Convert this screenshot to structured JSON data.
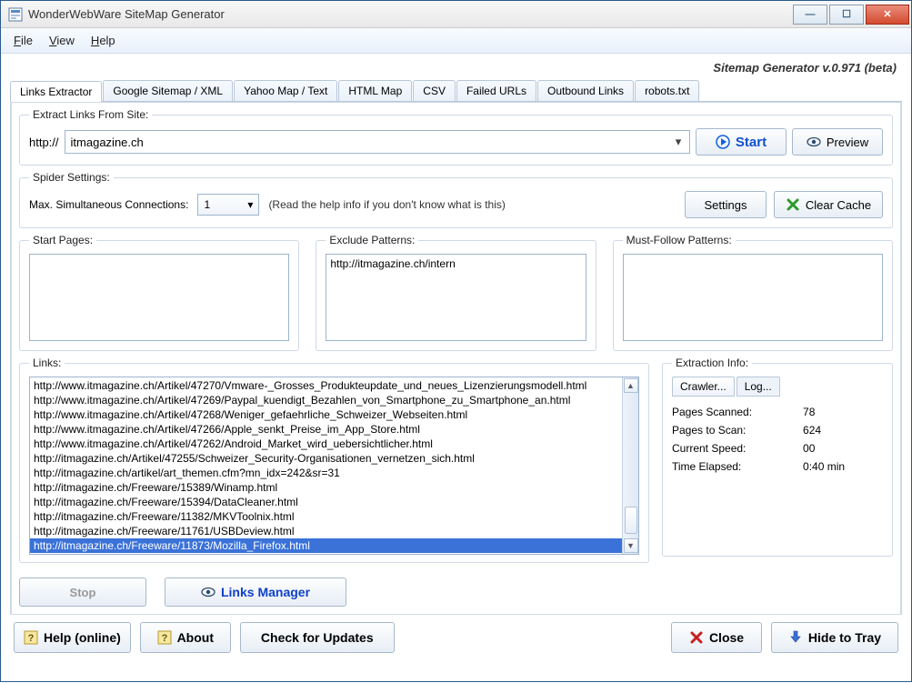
{
  "window": {
    "title": "WonderWebWare SiteMap Generator"
  },
  "menu": {
    "file": "File",
    "view": "View",
    "help": "Help"
  },
  "version": "Sitemap Generator v.0.971 (beta)",
  "tabs": [
    "Links Extractor",
    "Google Sitemap / XML",
    "Yahoo Map / Text",
    "HTML Map",
    "CSV",
    "Failed URLs",
    "Outbound Links",
    "robots.txt"
  ],
  "active_tab_index": 0,
  "extract": {
    "legend": "Extract Links From Site:",
    "protocol": "http://",
    "url": "itmagazine.ch",
    "start_label": "Start",
    "preview_label": "Preview"
  },
  "spider": {
    "legend": "Spider Settings:",
    "max_label": "Max. Simultaneous Connections:",
    "max_value": "1",
    "note": "(Read the help info if you don't know what is this)",
    "settings_label": "Settings",
    "clear_cache_label": "Clear Cache"
  },
  "patterns": {
    "start_legend": "Start Pages:",
    "start_value": "",
    "exclude_legend": "Exclude Patterns:",
    "exclude_value": "http://itmagazine.ch/intern",
    "must_legend": "Must-Follow Patterns:",
    "must_value": ""
  },
  "links": {
    "legend": "Links:",
    "items": [
      "http://www.itmagazine.ch/Artikel/47270/Vmware-_Grosses_Produkteupdate_und_neues_Lizenzierungsmodell.html",
      "http://www.itmagazine.ch/Artikel/47269/Paypal_kuendigt_Bezahlen_von_Smartphone_zu_Smartphone_an.html",
      "http://www.itmagazine.ch/Artikel/47268/Weniger_gefaehrliche_Schweizer_Webseiten.html",
      "http://www.itmagazine.ch/Artikel/47266/Apple_senkt_Preise_im_App_Store.html",
      "http://www.itmagazine.ch/Artikel/47262/Android_Market_wird_uebersichtlicher.html",
      "http://itmagazine.ch/Artikel/47255/Schweizer_Security-Organisationen_vernetzen_sich.html",
      "http://itmagazine.ch/artikel/art_themen.cfm?mn_idx=242&sr=31",
      "http://itmagazine.ch/Freeware/15389/Winamp.html",
      "http://itmagazine.ch/Freeware/15394/DataCleaner.html",
      "http://itmagazine.ch/Freeware/11382/MKVToolnix.html",
      "http://itmagazine.ch/Freeware/11761/USBDeview.html",
      "http://itmagazine.ch/Freeware/11873/Mozilla_Firefox.html"
    ],
    "selected_index": 11,
    "stop_label": "Stop",
    "manager_label": "Links Manager"
  },
  "info": {
    "legend": "Extraction Info:",
    "tab_crawler": "Crawler...",
    "tab_log": "Log...",
    "rows": [
      {
        "k": "Pages Scanned:",
        "v": "78"
      },
      {
        "k": "Pages to Scan:",
        "v": "624"
      },
      {
        "k": "Current Speed:",
        "v": "00"
      },
      {
        "k": "Time Elapsed:",
        "v": "0:40 min"
      }
    ]
  },
  "bottom": {
    "help": "Help (online)",
    "about": "About",
    "updates": "Check for Updates",
    "close": "Close",
    "hide": "Hide to Tray"
  }
}
